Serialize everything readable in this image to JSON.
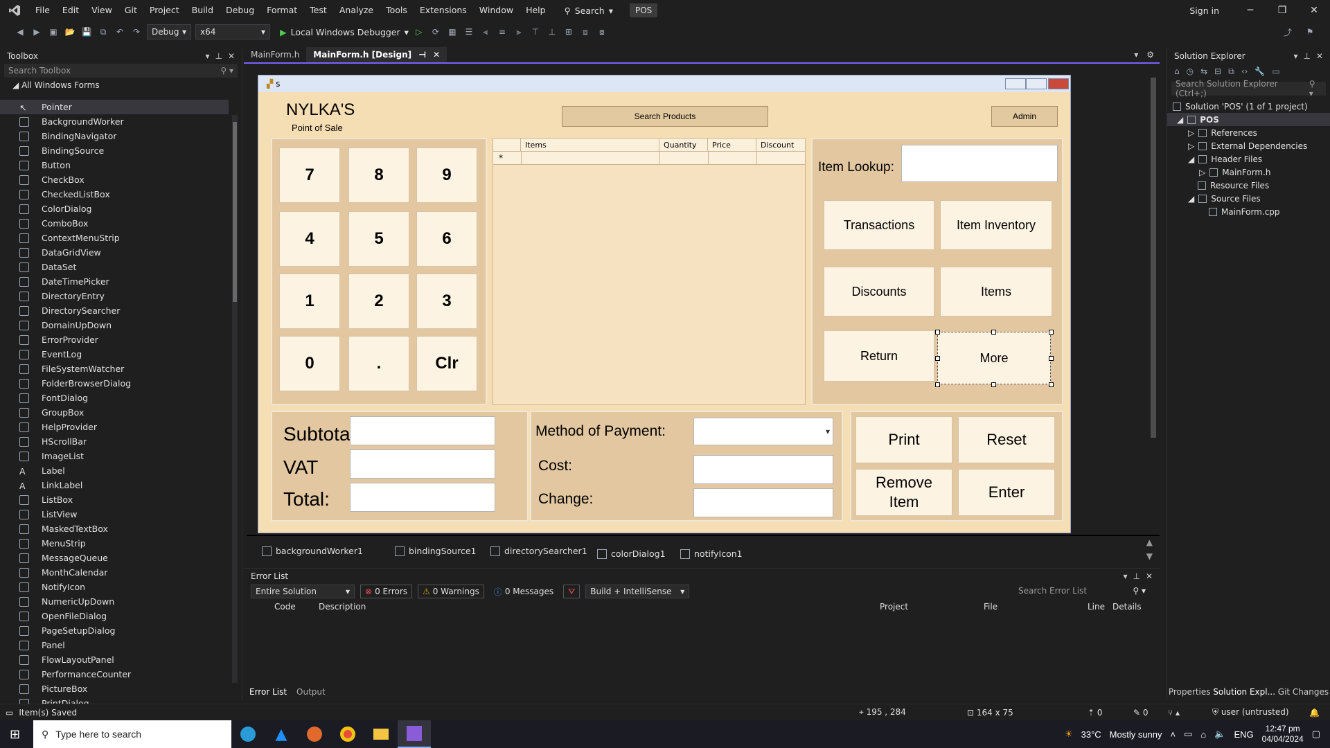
{
  "menubar": {
    "items": [
      "File",
      "Edit",
      "View",
      "Git",
      "Project",
      "Build",
      "Debug",
      "Format",
      "Test",
      "Analyze",
      "Tools",
      "Extensions",
      "Window",
      "Help"
    ],
    "search_label": "Search",
    "project_badge": "POS",
    "sign_in": "Sign in"
  },
  "toolbar": {
    "config": "Debug",
    "platform": "x64",
    "debugger": "Local Windows Debugger"
  },
  "toolbox": {
    "title": "Toolbox",
    "search_placeholder": "Search Toolbox",
    "group": "All Windows Forms",
    "items": [
      "Pointer",
      "BackgroundWorker",
      "BindingNavigator",
      "BindingSource",
      "Button",
      "CheckBox",
      "CheckedListBox",
      "ColorDialog",
      "ComboBox",
      "ContextMenuStrip",
      "DataGridView",
      "DataSet",
      "DateTimePicker",
      "DirectoryEntry",
      "DirectorySearcher",
      "DomainUpDown",
      "ErrorProvider",
      "EventLog",
      "FileSystemWatcher",
      "FolderBrowserDialog",
      "FontDialog",
      "GroupBox",
      "HelpProvider",
      "HScrollBar",
      "ImageList",
      "Label",
      "LinkLabel",
      "ListBox",
      "ListView",
      "MaskedTextBox",
      "MenuStrip",
      "MessageQueue",
      "MonthCalendar",
      "NotifyIcon",
      "NumericUpDown",
      "OpenFileDialog",
      "PageSetupDialog",
      "Panel",
      "FlowLayoutPanel",
      "PerformanceCounter",
      "PictureBox",
      "PrintDialog"
    ]
  },
  "doctabs": {
    "tab1": "MainForm.h",
    "tab2": "MainForm.h [Design]"
  },
  "form": {
    "title": "s",
    "brand": "NYLKA'S",
    "brand_sub": "Point of Sale",
    "search_products": "Search Products",
    "admin": "Admin",
    "keypad": [
      "7",
      "8",
      "9",
      "4",
      "5",
      "6",
      "1",
      "2",
      "3",
      "0",
      ".",
      "Clr"
    ],
    "grid_headers": [
      "Items",
      "Quantity",
      "Price",
      "Discount"
    ],
    "grid_newrow": "*",
    "item_lookup": "Item Lookup:",
    "actions": [
      "Transactions",
      "Item Inventory",
      "Discounts",
      "Items",
      "Return",
      "More"
    ],
    "subtotal": "Subtotal:",
    "vat": "VAT",
    "total": "Total:",
    "method_of_payment": "Method of Payment:",
    "cost": "Cost:",
    "change": "Change:",
    "print": "Print",
    "reset": "Reset",
    "remove_item_1": "Remove",
    "remove_item_2": "Item",
    "enter": "Enter"
  },
  "tray": {
    "items": [
      "backgroundWorker1",
      "bindingSource1",
      "directorySearcher1",
      "colorDialog1",
      "notifyIcon1"
    ]
  },
  "errorlist": {
    "title": "Error List",
    "scope": "Entire Solution",
    "errors": "0 Errors",
    "warnings": "0 Warnings",
    "messages": "0 Messages",
    "build_filter": "Build + IntelliSense",
    "search_placeholder": "Search Error List",
    "columns": [
      "Code",
      "Description",
      "Project",
      "File",
      "Line",
      "Details"
    ],
    "tab_errorlist": "Error List",
    "tab_output": "Output"
  },
  "solution": {
    "title": "Solution Explorer",
    "search_placeholder": "Search Solution Explorer (Ctrl+;)",
    "nodes": [
      "Solution 'POS' (1 of 1 project)",
      "POS",
      "References",
      "External Dependencies",
      "Header Files",
      "MainForm.h",
      "Resource Files",
      "Source Files",
      "MainForm.cpp"
    ],
    "tabs": [
      "Properties",
      "Solution Expl...",
      "Git Changes"
    ]
  },
  "statusbar": {
    "left": "Item(s) Saved",
    "position": "195 , 284",
    "size": "164 x 75",
    "changes": "0",
    "edits": "0",
    "user": "user (untrusted)"
  },
  "taskbar": {
    "search_placeholder": "Type here to search",
    "weather_temp": "33°C",
    "weather_desc": "Mostly sunny",
    "lang": "ENG",
    "time": "12:47 pm",
    "date": "04/04/2024"
  },
  "colors": {
    "form_bg": "#f5deb3",
    "accent": "#7b61ff",
    "ide_bg": "#1f1f1f"
  }
}
